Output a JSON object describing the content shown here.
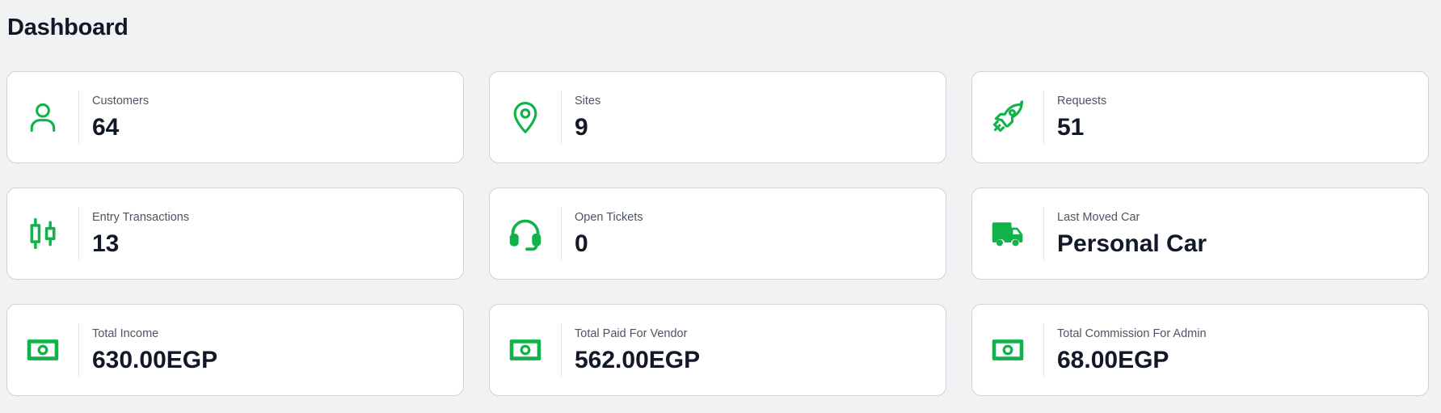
{
  "page": {
    "title": "Dashboard"
  },
  "theme": {
    "icon_color": "#10b34a",
    "background": "#f1f2f4",
    "card_border": "#cfd3d9"
  },
  "cards": [
    {
      "label": "Customers",
      "value": "64",
      "icon": "user-icon"
    },
    {
      "label": "Sites",
      "value": "9",
      "icon": "map-pin-icon"
    },
    {
      "label": "Requests",
      "value": "51",
      "icon": "rocket-icon"
    },
    {
      "label": "Entry Transactions",
      "value": "13",
      "icon": "candlestick-icon"
    },
    {
      "label": "Open Tickets",
      "value": "0",
      "icon": "headset-icon"
    },
    {
      "label": "Last Moved Car",
      "value": "Personal Car",
      "icon": "truck-icon"
    },
    {
      "label": "Total Income",
      "value": "630.00EGP",
      "icon": "cash-icon"
    },
    {
      "label": "Total Paid For Vendor",
      "value": "562.00EGP",
      "icon": "cash-icon"
    },
    {
      "label": "Total Commission For Admin",
      "value": "68.00EGP",
      "icon": "cash-icon"
    }
  ]
}
